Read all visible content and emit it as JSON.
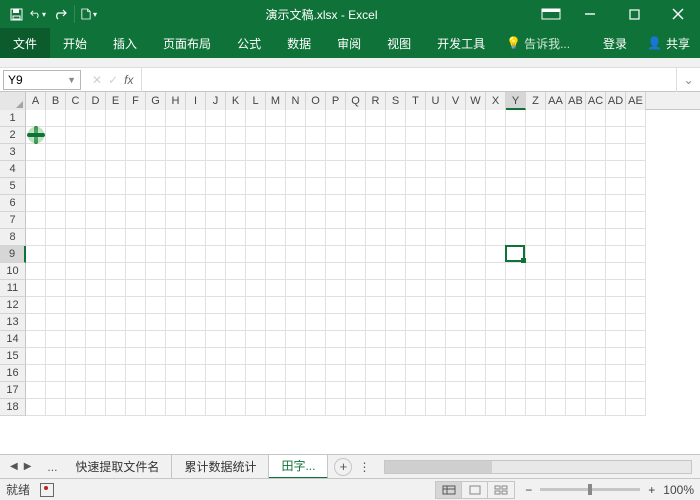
{
  "title": "演示文稿.xlsx - Excel",
  "qat": {
    "save": "save",
    "undo": "undo",
    "redo": "redo",
    "new": "new"
  },
  "ribbon": {
    "file": "文件",
    "home": "开始",
    "insert": "插入",
    "layout": "页面布局",
    "formula": "公式",
    "data": "数据",
    "review": "审阅",
    "view": "视图",
    "dev": "开发工具",
    "tell": "告诉我...",
    "login": "登录",
    "share": "共享"
  },
  "namebox": "Y9",
  "columns": [
    "A",
    "B",
    "C",
    "D",
    "E",
    "F",
    "G",
    "H",
    "I",
    "J",
    "K",
    "L",
    "M",
    "N",
    "O",
    "P",
    "Q",
    "R",
    "S",
    "T",
    "U",
    "V",
    "W",
    "X",
    "Y",
    "Z",
    "AA",
    "AB",
    "AC",
    "AD",
    "AE"
  ],
  "rowcount": 18,
  "active": {
    "col": "Y",
    "row": 9
  },
  "cursor": {
    "col": "A",
    "row": 2
  },
  "sheets": {
    "s1": "快速提取文件名",
    "s2": "累计数据统计",
    "s3": "田字..."
  },
  "status": {
    "ready": "就绪",
    "zoom": "100%"
  }
}
